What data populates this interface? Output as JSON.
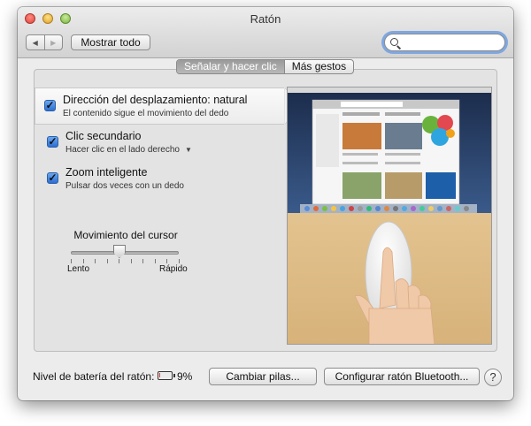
{
  "window": {
    "title": "Ratón"
  },
  "toolbar": {
    "back_glyph": "◀",
    "forward_glyph": "▶",
    "show_all_label": "Mostrar todo",
    "search_placeholder": ""
  },
  "tabs": [
    {
      "label": "Señalar y hacer clic",
      "active": true
    },
    {
      "label": "Más gestos",
      "active": false
    }
  ],
  "options": [
    {
      "title": "Dirección del desplazamiento: natural",
      "subtitle": "El contenido sigue el movimiento del dedo",
      "checked": true,
      "selected": true
    },
    {
      "title": "Clic secundario",
      "subtitle": "Hacer clic en el lado derecho",
      "checked": true,
      "has_dropdown": true
    },
    {
      "title": "Zoom inteligente",
      "subtitle": "Pulsar dos veces con un dedo",
      "checked": true
    }
  ],
  "checkmark_glyph": "✓",
  "dropdown_glyph": "▼",
  "cursor_speed": {
    "label": "Movimiento del cursor",
    "min_label": "Lento",
    "max_label": "Rápido",
    "level": 0.45,
    "tick_count": 10
  },
  "battery": {
    "label": "Nivel de batería del ratón:",
    "percent_text": "9%",
    "level": 0.09,
    "color": "#d63b2f"
  },
  "buttons": {
    "change_batteries": "Cambiar pilas...",
    "configure_bluetooth": "Configurar ratón Bluetooth...",
    "help": "?"
  },
  "colors": {
    "accent": "#2d6fd3",
    "window_bg": "#ececec",
    "tab_active": "#a8a8a8"
  }
}
